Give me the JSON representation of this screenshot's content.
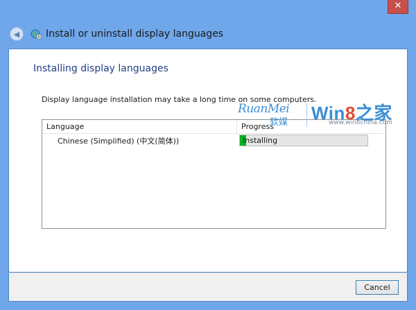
{
  "window": {
    "title": "Install or uninstall display languages",
    "close_label": "✕"
  },
  "page": {
    "heading": "Installing display languages",
    "description": "Display language installation may take a long time on some computers."
  },
  "list": {
    "columns": [
      "Language",
      "Progress"
    ],
    "rows": [
      {
        "language": "Chinese (Simplified) (中文(简体))",
        "status": "Installing",
        "progress_fraction": 0.05
      }
    ]
  },
  "footer": {
    "cancel_label": "Cancel"
  },
  "watermark": {
    "ruanmei": "RuanMei",
    "ruanmei_cn": "软媒",
    "win8_prefix": "Win",
    "win8_digit": "8",
    "win8_suffix": "之家",
    "url": "www.win8china.com"
  },
  "colors": {
    "accent_blue": "#6fa7ea",
    "heading_blue": "#1f3f86",
    "progress_green": "#06b025",
    "close_red": "#c7504b"
  }
}
